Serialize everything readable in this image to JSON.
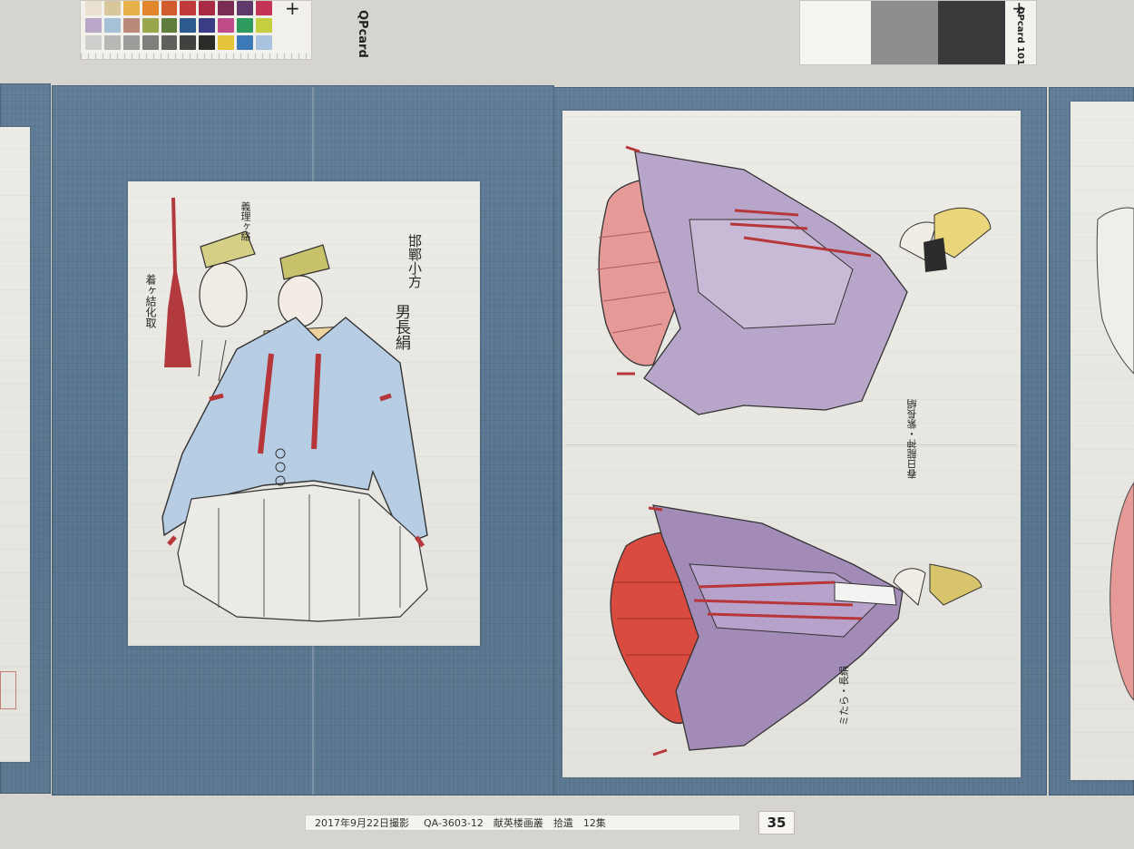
{
  "color_card": {
    "brand": "QPcard",
    "swatches": [
      "#e9e0cf",
      "#d7c79a",
      "#e8b24a",
      "#e2852c",
      "#d25b2d",
      "#c03b3a",
      "#a92a45",
      "#7a2c52",
      "#5d3a6b",
      "#c43457",
      "#b9a7c8",
      "#a4c1d8",
      "#b98a79",
      "#98a64c",
      "#5f7d3c",
      "#2d5b8f",
      "#3c3d87",
      "#c04b8b",
      "#2e9a5e",
      "#c4cf3f",
      "#cfd0cd",
      "#b8b8b6",
      "#9c9c9a",
      "#7f807e",
      "#5f605e",
      "#414240",
      "#2b2c2a",
      "#e4c53a",
      "#3c79b8",
      "#a9c3de"
    ]
  },
  "grey_card": {
    "brand": "QPcard 101",
    "steps": [
      "#f5f5f2",
      "#8d8d8f",
      "#3a3a3c"
    ]
  },
  "scroll": {
    "left_panel": {
      "inscriptions": [
        "邯鄲小方",
        "男長絹",
        "義理ヶ絡",
        "着ヶ結化取"
      ]
    },
    "right_panel": {
      "top_inscription": "春日龍神・紫長絹",
      "bottom_inscription": "ミたら・長絹"
    }
  },
  "caption": {
    "date": "2017年9月22日撮影",
    "title": "QA-3603-12　献英楼画叢　拾遺　12集"
  },
  "page_number": "35"
}
